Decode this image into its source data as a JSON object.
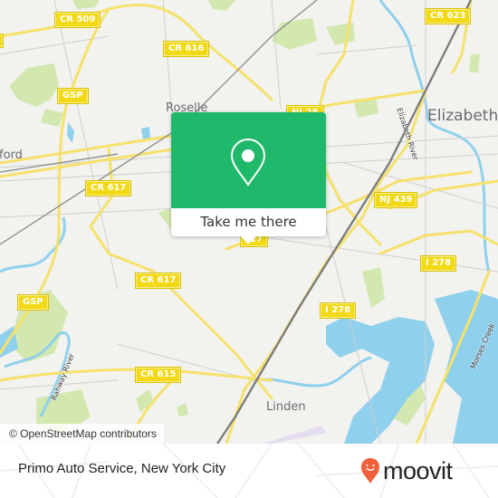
{
  "map": {
    "place_labels": [
      {
        "id": "roselle",
        "text": "Roselle"
      },
      {
        "id": "elizabeth",
        "text": "Elizabeth"
      },
      {
        "id": "cranford",
        "text": "ford"
      },
      {
        "id": "linden",
        "text": "Linden"
      }
    ],
    "water_labels": [
      {
        "id": "elizabeth-river",
        "text": "Elizabeth River"
      },
      {
        "id": "rahway-river",
        "text": "Rahway River"
      },
      {
        "id": "morses-creek",
        "text": "Morses Creek"
      }
    ],
    "road_shields": [
      {
        "id": "cr509",
        "text": "CR 509"
      },
      {
        "id": "cr616",
        "text": "CR 616"
      },
      {
        "id": "cr623",
        "text": "CR 623"
      },
      {
        "id": "gsp-north",
        "text": "GSP"
      },
      {
        "id": "nj28",
        "text": "NJ 28"
      },
      {
        "id": "cr617-a",
        "text": "CR 617"
      },
      {
        "id": "nj439",
        "text": "NJ 439"
      },
      {
        "id": "nj27",
        "text": "27"
      },
      {
        "id": "i278-east",
        "text": "I 278"
      },
      {
        "id": "cr617-b",
        "text": "CR 617"
      },
      {
        "id": "gsp-south",
        "text": "GSP"
      },
      {
        "id": "i278-south",
        "text": "I 278"
      },
      {
        "id": "cr615",
        "text": "CR 615"
      },
      {
        "id": "edge-left",
        "text": ""
      }
    ],
    "colors": {
      "land": "#f2f2ef",
      "road": "#f5e16b",
      "water": "#8fd0ec",
      "park": "#cfe7a8",
      "rail": "#8a8a8a",
      "popup_accent": "#20b96b",
      "brand_orange": "#f0603a"
    }
  },
  "popup": {
    "icon": "map-pin-icon",
    "button_label": "Take me there"
  },
  "attribution": "© OpenStreetMap contributors",
  "footer": {
    "title": "Primo Auto Service, New York City",
    "brand": "moovit",
    "brand_icon": "moovit-pin-icon"
  }
}
